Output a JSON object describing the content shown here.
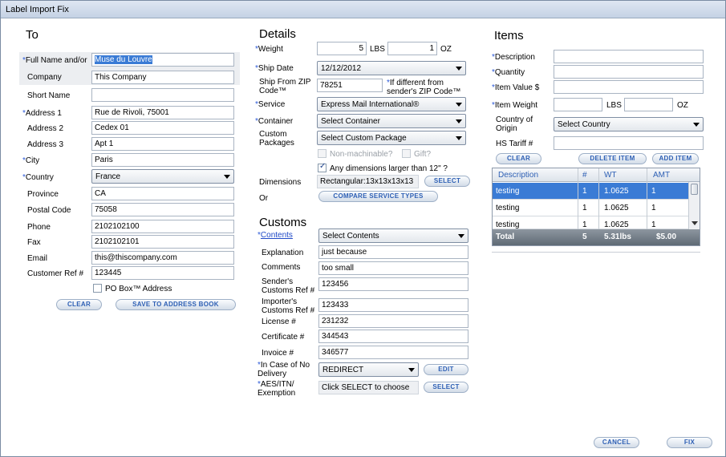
{
  "window": {
    "title": "Label Import Fix"
  },
  "to": {
    "heading": "To",
    "full_name_label": "Full Name and/or",
    "full_name_value": "Muse du Louvre",
    "company_label": "Company",
    "company_value": "This Company",
    "short_name_label": "Short Name",
    "short_name_value": "",
    "address1_label": "Address 1",
    "address1_value": "Rue de Rivoli, 75001",
    "address2_label": "Address 2",
    "address2_value": "Cedex 01",
    "address3_label": "Address 3",
    "address3_value": "Apt 1",
    "city_label": "City",
    "city_value": "Paris",
    "country_label": "Country",
    "country_value": "France",
    "province_label": "Province",
    "province_value": "CA",
    "postal_label": "Postal Code",
    "postal_value": "75058",
    "phone_label": "Phone",
    "phone_value": "2102102100",
    "fax_label": "Fax",
    "fax_value": "2102102101",
    "email_label": "Email",
    "email_value": "this@thiscompany.com",
    "custref_label": "Customer Ref #",
    "custref_value": "123445",
    "pobox_label": "PO Box™ Address",
    "clear_btn": "CLEAR",
    "save_btn": "SAVE TO ADDRESS BOOK"
  },
  "details": {
    "heading": "Details",
    "weight_label": "Weight",
    "weight_lbs": "5",
    "lbs_unit": "LBS",
    "weight_oz": "1",
    "oz_unit": "OZ",
    "ship_date_label": "Ship Date",
    "ship_date_value": "12/12/2012",
    "ship_from_zip_label": "Ship From ZIP Code™",
    "ship_from_zip_value": "78251",
    "zip_note": "If different from sender's ZIP Code™",
    "service_label": "Service",
    "service_value": "Express Mail International®",
    "container_label": "Container",
    "container_value": "Select Container",
    "custom_pkg_label": "Custom Packages",
    "custom_pkg_value": "Select Custom Package",
    "nonmach_label": "Non-machinable?",
    "gift_label": "Gift?",
    "larger_label": "Any dimensions larger than 12\" ?",
    "dimensions_label": "Dimensions",
    "dimensions_value": "Rectangular:13x13x13x13",
    "select_btn": "SELECT",
    "or_label": "Or",
    "compare_btn": "COMPARE SERVICE TYPES"
  },
  "customs": {
    "heading": "Customs",
    "contents_label": "Contents",
    "contents_value": "Select Contents",
    "explanation_label": "Explanation",
    "explanation_value": "just because",
    "comments_label": "Comments",
    "comments_value": "too small",
    "sender_ref_label": "Sender's Customs Ref #",
    "sender_ref_value": "123456",
    "importer_ref_label": "Importer's Customs Ref #",
    "importer_ref_value": "123433",
    "license_label": "License #",
    "license_value": "231232",
    "certificate_label": "Certificate #",
    "certificate_value": "344543",
    "invoice_label": "Invoice #",
    "invoice_value": "346577",
    "no_delivery_label": "In Case of No Delivery",
    "no_delivery_value": "REDIRECT",
    "edit_btn": "EDIT",
    "aes_label": "AES/ITN/ Exemption",
    "aes_value": "Click SELECT to choose",
    "select_btn": "SELECT"
  },
  "items": {
    "heading": "Items",
    "description_label": "Description",
    "quantity_label": "Quantity",
    "value_label": "Item Value $",
    "weight_label": "Item Weight",
    "lbs_unit": "LBS",
    "oz_unit": "OZ",
    "origin_label": "Country of Origin",
    "origin_value": "Select Country",
    "hs_label": "HS Tariff #",
    "clear_btn": "CLEAR",
    "delete_btn": "DELETE ITEM",
    "add_btn": "ADD ITEM",
    "table": {
      "headers": [
        "Description",
        "#",
        "WT",
        "AMT"
      ],
      "rows": [
        {
          "desc": "testing",
          "qty": "1",
          "wt": "1.0625",
          "amt": "1"
        },
        {
          "desc": "testing",
          "qty": "1",
          "wt": "1.0625",
          "amt": "1"
        },
        {
          "desc": "testing",
          "qty": "1",
          "wt": "1.0625",
          "amt": "1"
        }
      ],
      "total": {
        "label": "Total",
        "qty": "5",
        "wt": "5.31lbs",
        "amt": "$5.00"
      }
    }
  },
  "footer": {
    "cancel_btn": "CANCEL",
    "fix_btn": "FIX"
  },
  "colors": {
    "accent": "#2d5fb4",
    "selection": "#3a7bd5",
    "required_star": "#2a58d6"
  }
}
